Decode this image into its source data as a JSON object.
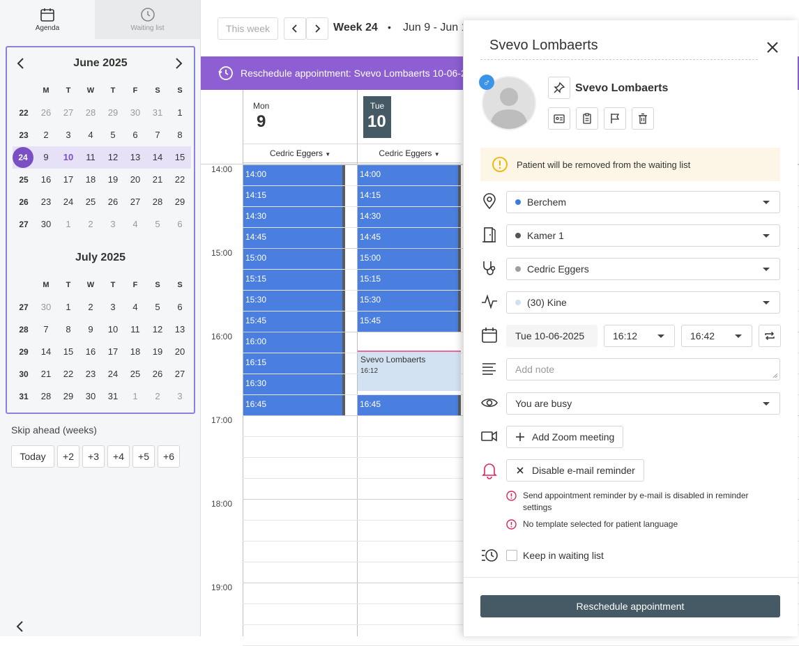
{
  "sidebar": {
    "tabs": [
      {
        "label": "Agenda",
        "icon": "calendar-icon"
      },
      {
        "label": "Waiting list",
        "icon": "clock-icon"
      }
    ],
    "months": [
      {
        "title": "June 2025",
        "weekday_headers": [
          "M",
          "T",
          "W",
          "T",
          "F",
          "S",
          "S"
        ],
        "weeks": [
          {
            "num": "22",
            "days": [
              "26",
              "27",
              "28",
              "29",
              "30",
              "31",
              "1"
            ],
            "muted": [
              true,
              true,
              true,
              true,
              true,
              true,
              false
            ]
          },
          {
            "num": "23",
            "days": [
              "2",
              "3",
              "4",
              "5",
              "6",
              "7",
              "8"
            ],
            "muted": [
              false,
              false,
              false,
              false,
              false,
              false,
              false
            ]
          },
          {
            "num": "24",
            "days": [
              "9",
              "10",
              "11",
              "12",
              "13",
              "14",
              "15"
            ],
            "muted": [
              false,
              false,
              false,
              false,
              false,
              false,
              false
            ],
            "selected": true
          },
          {
            "num": "25",
            "days": [
              "16",
              "17",
              "18",
              "19",
              "20",
              "21",
              "22"
            ],
            "muted": [
              false,
              false,
              false,
              false,
              false,
              false,
              false
            ]
          },
          {
            "num": "26",
            "days": [
              "23",
              "24",
              "25",
              "26",
              "27",
              "28",
              "29"
            ],
            "muted": [
              false,
              false,
              false,
              false,
              false,
              false,
              false
            ]
          },
          {
            "num": "27",
            "days": [
              "30",
              "1",
              "2",
              "3",
              "4",
              "5",
              "6"
            ],
            "muted": [
              false,
              true,
              true,
              true,
              true,
              true,
              true
            ]
          }
        ]
      },
      {
        "title": "July 2025",
        "weekday_headers": [
          "M",
          "T",
          "W",
          "T",
          "F",
          "S",
          "S"
        ],
        "weeks": [
          {
            "num": "27",
            "days": [
              "30",
              "1",
              "2",
              "3",
              "4",
              "5",
              "6"
            ],
            "muted": [
              true,
              false,
              false,
              false,
              false,
              false,
              false
            ]
          },
          {
            "num": "28",
            "days": [
              "7",
              "8",
              "9",
              "10",
              "11",
              "12",
              "13"
            ],
            "muted": [
              false,
              false,
              false,
              false,
              false,
              false,
              false
            ]
          },
          {
            "num": "29",
            "days": [
              "14",
              "15",
              "16",
              "17",
              "18",
              "19",
              "20"
            ],
            "muted": [
              false,
              false,
              false,
              false,
              false,
              false,
              false
            ]
          },
          {
            "num": "30",
            "days": [
              "21",
              "22",
              "23",
              "24",
              "25",
              "26",
              "27"
            ],
            "muted": [
              false,
              false,
              false,
              false,
              false,
              false,
              false
            ]
          },
          {
            "num": "31",
            "days": [
              "28",
              "29",
              "30",
              "31",
              "1",
              "2",
              "3"
            ],
            "muted": [
              false,
              false,
              false,
              false,
              true,
              true,
              true
            ]
          }
        ]
      }
    ],
    "skip_label": "Skip ahead (weeks)",
    "skip_buttons": [
      "Today",
      "+2",
      "+3",
      "+4",
      "+5",
      "+6"
    ]
  },
  "toolbar": {
    "this_week": "This week",
    "week_label": "Week 24",
    "bullet": "•",
    "range": "Jun 9 - Jun 1"
  },
  "banner": {
    "text": "Reschedule appointment: Svevo Lombaerts 10-06-2"
  },
  "calendar": {
    "days": [
      {
        "name": "Mon",
        "num": "9",
        "provider_first": "Cedric ",
        "provider_last": "Eggers"
      },
      {
        "name": "Tue",
        "num": "10",
        "provider_first": "Cedric ",
        "provider_last": "Eggers",
        "today": true
      }
    ],
    "hours": [
      "14:00",
      "15:00",
      "16:00",
      "17:00",
      "18:00",
      "19:00"
    ],
    "mon_slots": [
      "14:00",
      "14:15",
      "14:30",
      "14:45",
      "15:00",
      "15:15",
      "15:30",
      "15:45",
      "16:00",
      "16:15",
      "16:30",
      "16:45"
    ],
    "tue_slots": [
      "14:00",
      "14:15",
      "14:30",
      "14:45",
      "15:00",
      "15:15",
      "15:30",
      "15:45",
      "16:45"
    ],
    "tue_slot_indexes": [
      0,
      1,
      2,
      3,
      4,
      5,
      6,
      7,
      11
    ],
    "appointment": {
      "name": "Svevo Lombaerts",
      "time": "16:12"
    }
  },
  "dialog": {
    "title": "Svevo Lombaerts",
    "patient_name": "Svevo Lombaerts",
    "gender_symbol": "♂",
    "warning": "Patient will be removed from the waiting list",
    "location": {
      "value": "Berchem",
      "color": "#3a7be0"
    },
    "room": {
      "value": "Kamer 1",
      "color": "#555555"
    },
    "practitioner": {
      "value": "Cedric Eggers",
      "color": "#9e9e9e"
    },
    "type": {
      "value": "(30) Kine",
      "color": "#cfe0f3"
    },
    "date": "Tue 10-06-2025",
    "start_time": "16:12",
    "end_time": "16:42",
    "note_placeholder": "Add note",
    "availability": "You are busy",
    "zoom_button": "Add Zoom meeting",
    "reminder_button": "Disable e-mail reminder",
    "errors": [
      "Send appointment reminder by e-mail is disabled in reminder settings",
      "No template selected for patient language"
    ],
    "keep_waiting": "Keep in waiting list",
    "submit": "Reschedule appointment"
  },
  "colors": {
    "accent": "#8d5fd3",
    "slot": "#4a7fe0",
    "dark_button": "#455a64",
    "warning_bg": "#fdf6e6",
    "error": "#e0245e"
  }
}
